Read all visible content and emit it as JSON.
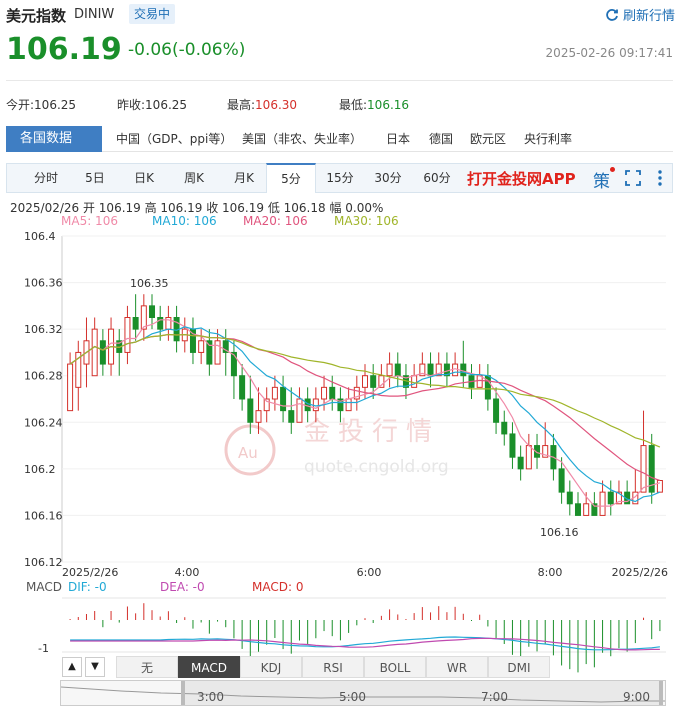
{
  "header": {
    "name": "美元指数",
    "code": "DINIW",
    "status_badge": "交易中",
    "refresh_label": "刷新行情"
  },
  "quote": {
    "price": "106.19",
    "change": "-0.06(-0.06%)",
    "timestamp": "2025-02-26 09:17:41"
  },
  "stats": {
    "open_label": "今开:",
    "open": "106.25",
    "prev_close_label": "昨收:",
    "prev_close": "106.25",
    "high_label": "最高:",
    "high": "106.30",
    "low_label": "最低:",
    "low": "106.16"
  },
  "country_tabs": [
    {
      "label": "各国数据",
      "active": true
    },
    {
      "label": "中国（GDP、ppi等）",
      "active": false
    },
    {
      "label": "美国（非农、失业率）",
      "active": false
    },
    {
      "label": "日本",
      "active": false
    },
    {
      "label": "德国",
      "active": false
    },
    {
      "label": "欧元区",
      "active": false
    },
    {
      "label": "央行利率",
      "active": false
    }
  ],
  "period_tabs": [
    {
      "label": "分时"
    },
    {
      "label": "5日"
    },
    {
      "label": "日K"
    },
    {
      "label": "周K"
    },
    {
      "label": "月K"
    },
    {
      "label": "5分"
    },
    {
      "label": "15分"
    },
    {
      "label": "30分"
    },
    {
      "label": "60分"
    }
  ],
  "active_period": "5分",
  "promo_label": "打开金投网APP",
  "strategy_label": "策",
  "ohlc_line": "2025/02/26  开 106.19  高 106.19  收 106.19  低 106.18  幅 0.00%",
  "ma_legend": [
    {
      "label": "MA5: 106",
      "color": "#f08aa8"
    },
    {
      "label": "MA10: 106",
      "color": "#22a9d6"
    },
    {
      "label": "MA20: 106",
      "color": "#e0557e"
    },
    {
      "label": "MA30: 106",
      "color": "#a0b52a"
    }
  ],
  "watermark": {
    "text": "金投行情",
    "sub": "quote.cngold.org",
    "logo": "Au"
  },
  "colors": {
    "up": "#d4302b",
    "down": "#1a8f2a",
    "accent": "#3f7ec3"
  },
  "chart_data": {
    "type": "candlestick",
    "y_ticks": [
      "106.4",
      "106.36",
      "106.32",
      "106.28",
      "106.24",
      "106.2",
      "106.16",
      "106.12"
    ],
    "ylim": [
      106.12,
      106.4
    ],
    "x_ticks": [
      "2025/2/26",
      "4:00",
      "6:00",
      "8:00",
      "2025/2/26"
    ],
    "annotations": [
      {
        "label": "106.35",
        "value": 106.35
      },
      {
        "label": "106.16",
        "value": 106.16
      }
    ],
    "candles": [
      [
        106.25,
        106.29,
        106.26,
        106.3
      ],
      [
        106.27,
        106.3,
        106.25,
        106.31
      ],
      [
        106.29,
        106.31,
        106.27,
        106.33
      ],
      [
        106.28,
        106.32,
        106.28,
        106.33
      ],
      [
        106.31,
        106.29,
        106.28,
        106.32
      ],
      [
        106.29,
        106.32,
        106.28,
        106.33
      ],
      [
        106.31,
        106.3,
        106.28,
        106.32
      ],
      [
        106.3,
        106.33,
        106.29,
        106.34
      ],
      [
        106.33,
        106.32,
        106.31,
        106.35
      ],
      [
        106.32,
        106.34,
        106.31,
        106.35
      ],
      [
        106.34,
        106.33,
        106.32,
        106.35
      ],
      [
        106.33,
        106.32,
        106.31,
        106.34
      ],
      [
        106.32,
        106.33,
        106.31,
        106.34
      ],
      [
        106.33,
        106.31,
        106.3,
        106.34
      ],
      [
        106.31,
        106.32,
        106.3,
        106.33
      ],
      [
        106.32,
        106.3,
        106.29,
        106.33
      ],
      [
        106.3,
        106.31,
        106.29,
        106.32
      ],
      [
        106.31,
        106.29,
        106.28,
        106.32
      ],
      [
        106.29,
        106.31,
        106.29,
        106.32
      ],
      [
        106.31,
        106.3,
        106.28,
        106.32
      ],
      [
        106.3,
        106.28,
        106.26,
        106.31
      ],
      [
        106.28,
        106.26,
        106.25,
        106.29
      ],
      [
        106.26,
        106.24,
        106.23,
        106.28
      ],
      [
        106.24,
        106.25,
        106.23,
        106.27
      ],
      [
        106.25,
        106.26,
        106.24,
        106.27
      ],
      [
        106.26,
        106.27,
        106.25,
        106.28
      ],
      [
        106.27,
        106.25,
        106.24,
        106.28
      ],
      [
        106.25,
        106.24,
        106.23,
        106.27
      ],
      [
        106.24,
        106.26,
        106.24,
        106.27
      ],
      [
        106.26,
        106.25,
        106.24,
        106.27
      ],
      [
        106.25,
        106.26,
        106.24,
        106.27
      ],
      [
        106.26,
        106.27,
        106.25,
        106.28
      ],
      [
        106.27,
        106.26,
        106.25,
        106.28
      ],
      [
        106.26,
        106.25,
        106.24,
        106.27
      ],
      [
        106.25,
        106.26,
        106.25,
        106.27
      ],
      [
        106.26,
        106.27,
        106.25,
        106.28
      ],
      [
        106.27,
        106.28,
        106.26,
        106.29
      ],
      [
        106.28,
        106.27,
        106.26,
        106.29
      ],
      [
        106.27,
        106.28,
        106.27,
        106.29
      ],
      [
        106.28,
        106.29,
        106.27,
        106.3
      ],
      [
        106.29,
        106.28,
        106.27,
        106.3
      ],
      [
        106.28,
        106.27,
        106.26,
        106.29
      ],
      [
        106.27,
        106.28,
        106.27,
        106.29
      ],
      [
        106.28,
        106.29,
        106.28,
        106.3
      ],
      [
        106.29,
        106.28,
        106.27,
        106.3
      ],
      [
        106.28,
        106.29,
        106.28,
        106.3
      ],
      [
        106.29,
        106.28,
        106.27,
        106.3
      ],
      [
        106.28,
        106.29,
        106.28,
        106.3
      ],
      [
        106.29,
        106.28,
        106.27,
        106.31
      ],
      [
        106.28,
        106.27,
        106.26,
        106.29
      ],
      [
        106.27,
        106.28,
        106.27,
        106.29
      ],
      [
        106.28,
        106.26,
        106.25,
        106.29
      ],
      [
        106.26,
        106.24,
        106.23,
        106.27
      ],
      [
        106.24,
        106.23,
        106.22,
        106.25
      ],
      [
        106.23,
        106.21,
        106.2,
        106.24
      ],
      [
        106.21,
        106.2,
        106.19,
        106.22
      ],
      [
        106.2,
        106.22,
        106.2,
        106.23
      ],
      [
        106.22,
        106.21,
        106.2,
        106.23
      ],
      [
        106.21,
        106.22,
        106.21,
        106.24
      ],
      [
        106.22,
        106.2,
        106.19,
        106.23
      ],
      [
        106.2,
        106.18,
        106.17,
        106.21
      ],
      [
        106.18,
        106.17,
        106.16,
        106.19
      ],
      [
        106.17,
        106.16,
        106.16,
        106.18
      ],
      [
        106.16,
        106.17,
        106.16,
        106.18
      ],
      [
        106.17,
        106.16,
        106.16,
        106.18
      ],
      [
        106.16,
        106.18,
        106.16,
        106.19
      ],
      [
        106.18,
        106.17,
        106.16,
        106.19
      ],
      [
        106.17,
        106.18,
        106.17,
        106.19
      ],
      [
        106.18,
        106.17,
        106.17,
        106.19
      ],
      [
        106.17,
        106.18,
        106.17,
        106.2
      ],
      [
        106.18,
        106.22,
        106.18,
        106.25
      ],
      [
        106.22,
        106.18,
        106.17,
        106.23
      ],
      [
        106.18,
        106.19,
        106.18,
        106.19
      ]
    ]
  },
  "macd": {
    "name": "MACD",
    "dif": "DIF: -0",
    "dea": "DEA: -0",
    "macd": "MACD: 0",
    "y_tick": "-1"
  },
  "indicator_tabs": [
    {
      "label": "无"
    },
    {
      "label": "MACD"
    },
    {
      "label": "KDJ"
    },
    {
      "label": "RSI"
    },
    {
      "label": "BOLL"
    },
    {
      "label": "WR"
    },
    {
      "label": "DMI"
    }
  ],
  "active_indicator": "MACD",
  "navigator_labels": [
    "3:00",
    "5:00",
    "7:00",
    "9:00"
  ]
}
